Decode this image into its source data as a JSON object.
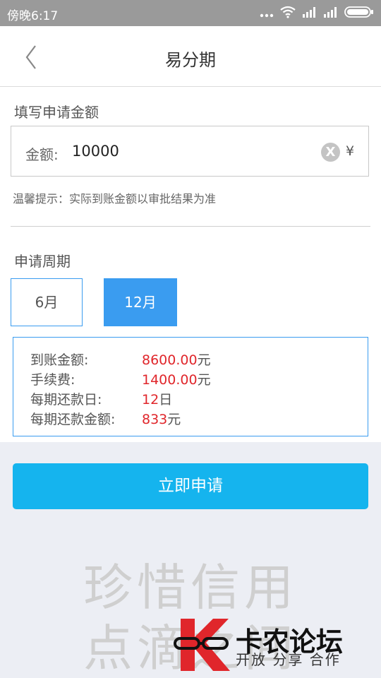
{
  "status_bar": {
    "time": "傍晚6:17"
  },
  "header": {
    "title": "易分期"
  },
  "amount_section": {
    "label": "填写申请金额",
    "field_label": "金额:",
    "value": "10000",
    "clear_glyph": "X",
    "currency": "¥",
    "hint": "温馨提示：实际到账金额以审批结果为准"
  },
  "period_section": {
    "label": "申请周期",
    "options": [
      {
        "label": "6月",
        "selected": false
      },
      {
        "label": "12月",
        "selected": true
      }
    ]
  },
  "summary": {
    "rows": [
      {
        "label": "到账金额:",
        "value": "8600.00",
        "unit": "元"
      },
      {
        "label": "手续费:",
        "value": "1400.00",
        "unit": "元"
      },
      {
        "label": "每期还款日:",
        "value": "12",
        "unit": "日"
      },
      {
        "label": "每期还款金额:",
        "value": "833",
        "unit": "元"
      }
    ]
  },
  "submit": {
    "label": "立即申请"
  },
  "slogan": {
    "line1": "珍惜信用",
    "line2": "点滴之间"
  },
  "watermark": {
    "name": "卡农论坛",
    "tagline": "开放 分享 合作"
  },
  "colors": {
    "accent": "#3a9cf0",
    "submit": "#15b4ee",
    "value_red": "#e0262b",
    "status_bar": "#9a9a9a"
  }
}
